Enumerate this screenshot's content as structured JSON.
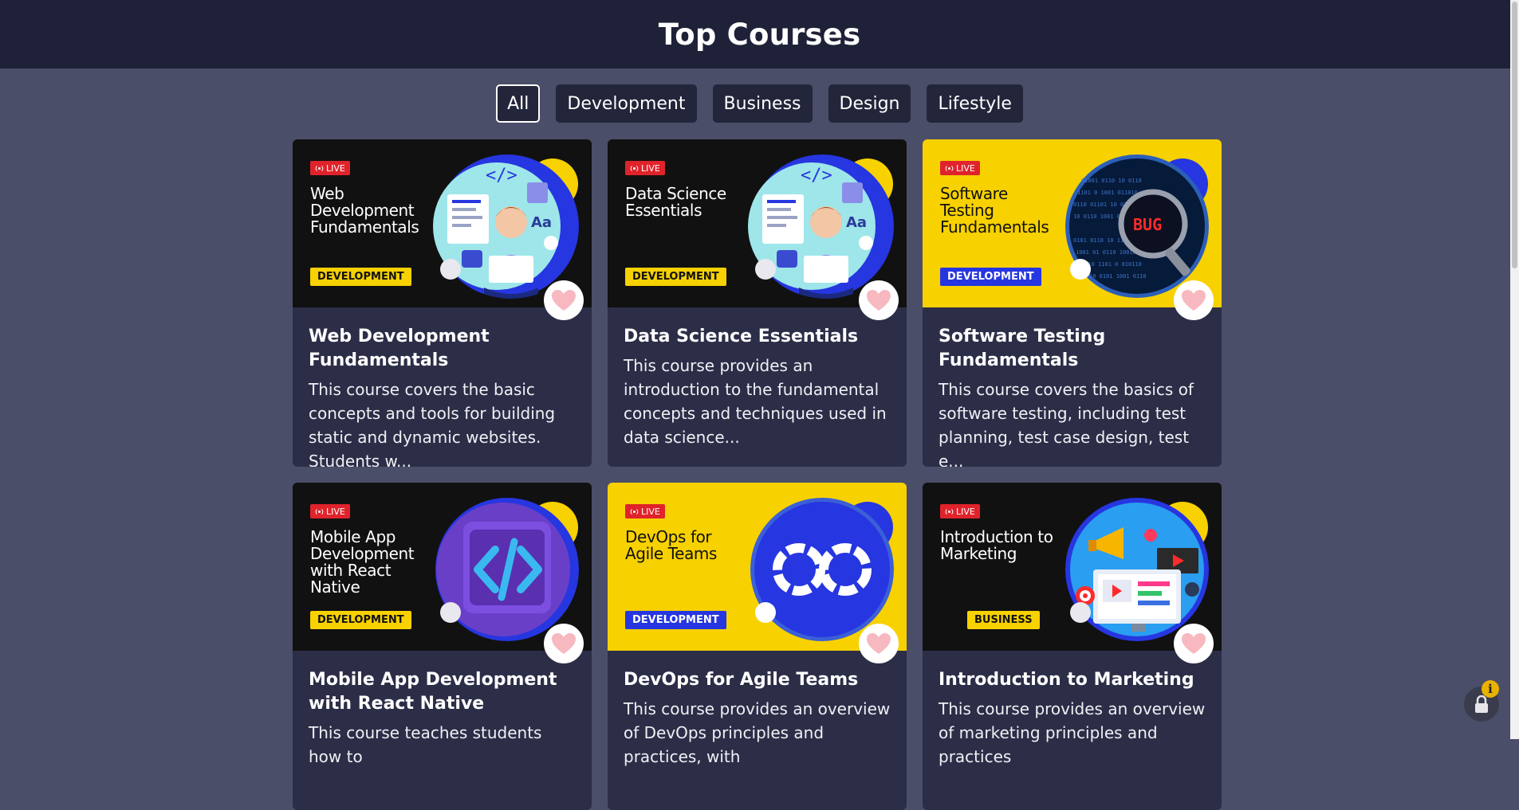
{
  "header": {
    "title": "Top Courses"
  },
  "filters": [
    "All",
    "Development",
    "Business",
    "Design",
    "Lifestyle"
  ],
  "active_filter": "All",
  "live_label": "LIVE",
  "courses": [
    {
      "banner_title": "Web Development Fundamentals",
      "category": "DEVELOPMENT",
      "title": "Web Development Fundamentals",
      "description": "This course covers the basic concepts and tools for building static and dynamic websites. Students w...",
      "theme": "dark",
      "illustration": "developer-illustration"
    },
    {
      "banner_title": "Data Science Essentials",
      "category": "DEVELOPMENT",
      "title": "Data Science Essentials",
      "description": "This course provides an introduction to the fundamental concepts and techniques used in data science...",
      "theme": "dark",
      "illustration": "developer-illustration"
    },
    {
      "banner_title": "Software Testing Fundamentals",
      "category": "DEVELOPMENT",
      "title": "Software Testing Fundamentals",
      "description": "This course covers the basics of software testing, including test planning, test case design, test e...",
      "theme": "yellow",
      "illustration": "bug-magnifier-illustration"
    },
    {
      "banner_title": "Mobile App Development with React Native",
      "category": "DEVELOPMENT",
      "title": "Mobile App Development with React Native",
      "description": "This course teaches students how to",
      "theme": "dark",
      "illustration": "code-brackets-illustration"
    },
    {
      "banner_title": "DevOps for Agile Teams",
      "category": "DEVELOPMENT",
      "title": "DevOps for Agile Teams",
      "description": "This course provides an overview of DevOps principles and practices, with",
      "theme": "yellow",
      "illustration": "infinity-loop-illustration"
    },
    {
      "banner_title": "Introduction to Marketing",
      "category": "BUSINESS",
      "title": "Introduction to Marketing",
      "description": "This course provides an overview of marketing principles and practices",
      "theme": "dark",
      "illustration": "marketing-screen-illustration"
    }
  ],
  "bug_text": "BUG",
  "colors": {
    "page_bg": "#4b4e68",
    "header_bg": "#1f2138",
    "card_bg": "#2c2e48",
    "live_red": "#e0232b",
    "category_yellow": "#f7d100",
    "category_blue": "#2636e0",
    "heart_pink": "#f7b8c0",
    "circle_blue": "#2636e0"
  },
  "icons": [
    "heart-icon",
    "broadcast-icon",
    "lock-icon",
    "info-icon"
  ]
}
